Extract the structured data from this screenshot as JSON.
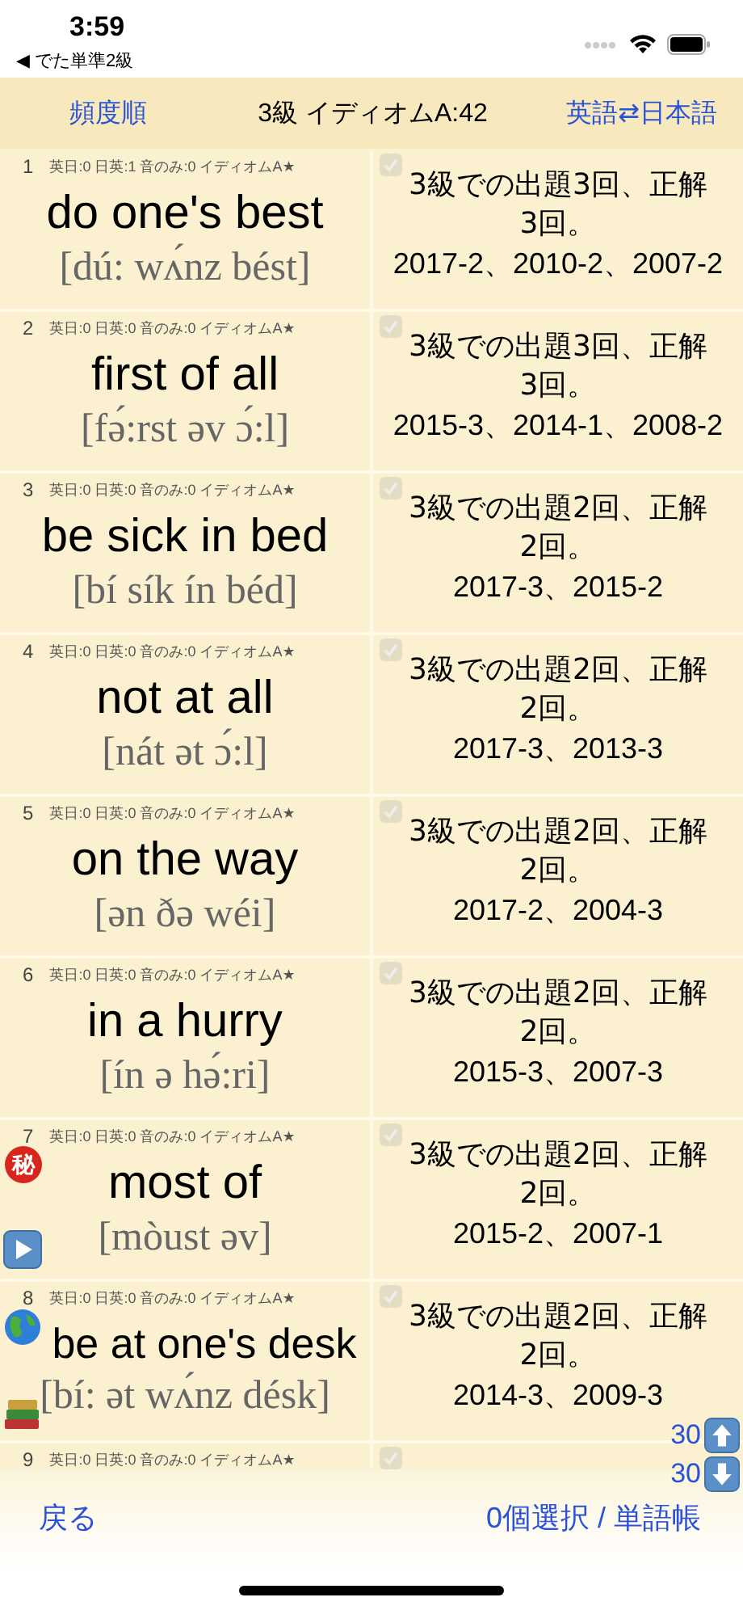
{
  "status_bar": {
    "time": "3:59",
    "back_app": "◀ でた単準2級"
  },
  "nav": {
    "left": "頻度順",
    "title": "3級 イディオムA:42",
    "right": "英語⇄日本語"
  },
  "rows": [
    {
      "number": "1",
      "stats": "英日:0 日英:1 音のみ:0 イディオムA★",
      "word": "do one's best",
      "pronunciation": "[dú: wʌ́nz bést]",
      "checked": false,
      "answer_lines": [
        "3級での出題3回、正解",
        "3回。"
      ],
      "dates": "2017-2、2010-2、2007-2"
    },
    {
      "number": "2",
      "stats": "英日:0 日英:0 音のみ:0 イディオムA★",
      "word": "first of all",
      "pronunciation": "[fə́:rst əv ɔ́:l]",
      "checked": false,
      "answer_lines": [
        "3級での出題3回、正解",
        "3回。"
      ],
      "dates": "2015-3、2014-1、2008-2"
    },
    {
      "number": "3",
      "stats": "英日:0 日英:0 音のみ:0 イディオムA★",
      "word": "be sick in bed",
      "pronunciation": "[bí sík ín béd]",
      "checked": false,
      "answer_lines": [
        "3級での出題2回、正解",
        "2回。"
      ],
      "dates": "2017-3、2015-2"
    },
    {
      "number": "4",
      "stats": "英日:0 日英:0 音のみ:0 イディオムA★",
      "word": "not at all",
      "pronunciation": "[nát ət ɔ́:l]",
      "checked": false,
      "answer_lines": [
        "3級での出題2回、正解",
        "2回。"
      ],
      "dates": "2017-3、2013-3"
    },
    {
      "number": "5",
      "stats": "英日:0 日英:0 音のみ:0 イディオムA★",
      "word": "on the way",
      "pronunciation": "[ən ðə wéi]",
      "checked": false,
      "answer_lines": [
        "3級での出題2回、正解",
        "2回。"
      ],
      "dates": "2017-2、2004-3"
    },
    {
      "number": "6",
      "stats": "英日:0 日英:0 音のみ:0 イディオムA★",
      "word": "in a hurry",
      "pronunciation": "[ín ə hə́:ri]",
      "checked": false,
      "answer_lines": [
        "3級での出題2回、正解",
        "2回。"
      ],
      "dates": "2015-3、2007-3"
    },
    {
      "number": "7",
      "stats": "英日:0 日英:0 音のみ:0 イディオムA★",
      "word": "most of",
      "pronunciation": "[mòust əv]",
      "checked": false,
      "answer_lines": [
        "3級での出題2回、正解",
        "2回。"
      ],
      "dates": "2015-2、2007-1",
      "extras": [
        {
          "kind": "secret",
          "label": "秘"
        },
        {
          "kind": "play"
        }
      ]
    },
    {
      "number": "8",
      "stats": "英日:0 日英:0 音のみ:0 イディオムA★",
      "word": "be at one's desk",
      "pronunciation": "[bí: ət wʌ́nz désk]",
      "checked": false,
      "answer_lines": [
        "3級での出題2回、正解",
        "2回。"
      ],
      "dates": "2014-3、2009-3",
      "extras": [
        {
          "kind": "globe"
        },
        {
          "kind": "books"
        }
      ]
    },
    {
      "number": "9",
      "stats": "英日:0 日英:0 音のみ:0 イディオムA★",
      "checked": false
    }
  ],
  "scroll_buttons": [
    {
      "kind": "up",
      "label": "30"
    },
    {
      "kind": "down",
      "label": "30"
    }
  ],
  "toolbar": {
    "left": "戻る",
    "right": "0個選択 / 単語帳"
  }
}
